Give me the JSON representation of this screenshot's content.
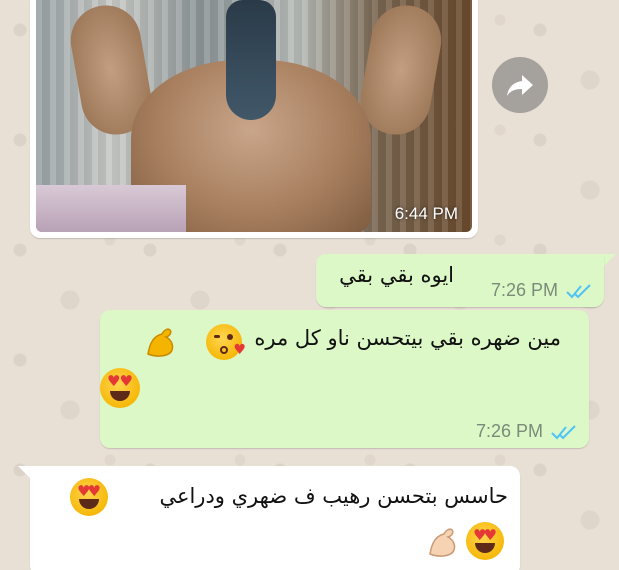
{
  "image_message": {
    "time": "6:44 PM",
    "content_icon": "photo-flexing-back"
  },
  "share_button": {
    "icon": "forward-arrow-icon"
  },
  "messages": [
    {
      "direction": "outgoing",
      "text": "ايوه بقي بقي",
      "time": "7:26 PM",
      "status": "read-double-tick",
      "emojis": []
    },
    {
      "direction": "outgoing",
      "text": "مين ضهره بقي بيتحسن ناو كل مره",
      "time": "7:26 PM",
      "status": "read-double-tick",
      "emojis": [
        "face-blowing-kiss-icon",
        "flexed-biceps-icon",
        "heart-eyes-icon"
      ]
    },
    {
      "direction": "incoming",
      "text": "حاسس بتحسن رهيب ف ضهري ودراعي",
      "emojis": [
        "heart-eyes-icon",
        "heart-eyes-icon",
        "flexed-biceps-light-icon"
      ]
    }
  ],
  "colors": {
    "outgoing_bubble": "#dcf8c6",
    "incoming_bubble": "#ffffff",
    "read_ticks": "#4fc3f7",
    "meta_text": "#7b8a7a",
    "wallpaper": "#e8dfd5"
  }
}
